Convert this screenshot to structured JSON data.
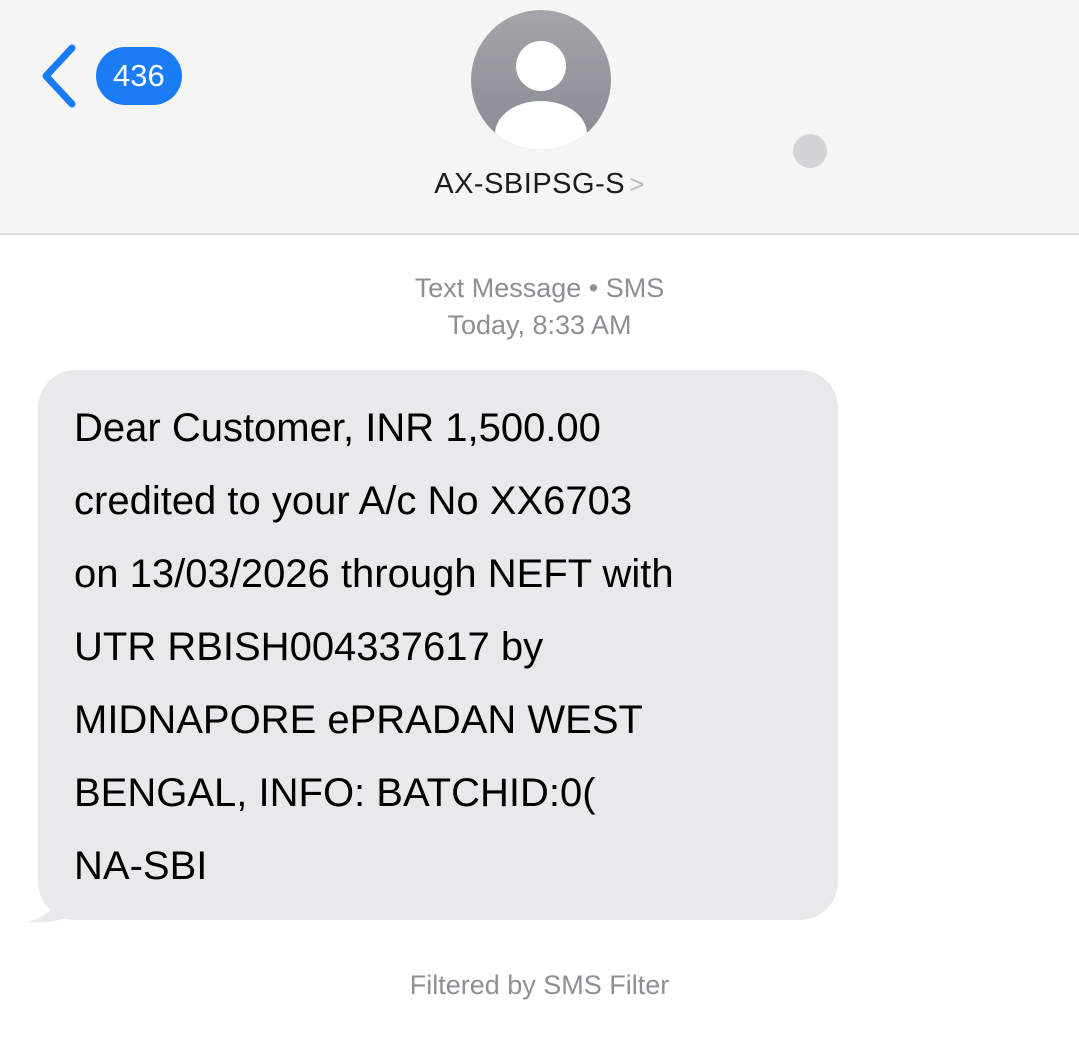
{
  "header": {
    "back_badge": "436",
    "contact_name": "AX-SBIPSG-S",
    "contact_chevron": ">"
  },
  "meta": {
    "line1": "Text Message • SMS",
    "line2": "Today, 8:33 AM"
  },
  "message": {
    "text": "Dear Customer, INR 1,500.00\ncredited to your A/c No XX6703\non 13/03/2026 through NEFT with\nUTR RBISH004337617     by\nMIDNAPORE ePRADAN WEST\nBENGAL, INFO: BATCHID:0(\nNA-SBI"
  },
  "footer": {
    "note": "Filtered by SMS Filter"
  },
  "colors": {
    "accent": "#1a7cf5",
    "bubble": "#e9e9eb",
    "header_bg": "#f5f5f5",
    "secondary_text": "#8e8e93"
  },
  "icons": {
    "back": "chevron-left-icon",
    "avatar": "person-icon"
  }
}
